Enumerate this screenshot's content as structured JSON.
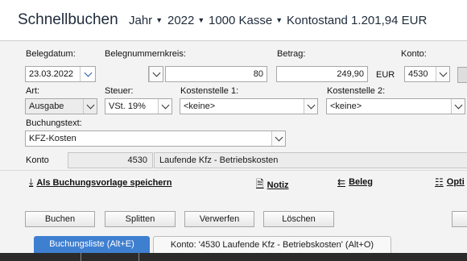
{
  "header": {
    "title": "Schnellbuchen",
    "period_type": "Jahr",
    "year": "2022",
    "account": "1000 Kasse",
    "balance": "Kontostand 1.201,94 EUR"
  },
  "form": {
    "belegdatum_label": "Belegdatum:",
    "belegdatum_value": "23.03.2022",
    "belegnummernkreis_label": "Belegnummernkreis:",
    "belegnummer_value": "80",
    "betrag_label": "Betrag:",
    "betrag_value": "249,90",
    "currency": "EUR",
    "konto_label": "Konto:",
    "konto_value": "4530",
    "art_label": "Art:",
    "art_value": "Ausgabe",
    "steuer_label": "Steuer:",
    "steuer_value": "VSt. 19%",
    "kostenstelle1_label": "Kostenstelle 1:",
    "kostenstelle1_value": "<keine>",
    "kostenstelle2_label": "Kostenstelle 2:",
    "kostenstelle2_value": "<keine>",
    "buchungstext_label": "Buchungstext:",
    "buchungstext_value": "KFZ-Kosten"
  },
  "konto_info": {
    "label": "Konto",
    "number": "4530",
    "description": "Laufende Kfz - Betriebskosten"
  },
  "actions": {
    "save_template": "Als Buchungsvorlage speichern",
    "notiz": "Notiz",
    "beleg": "Beleg",
    "options": "Opti"
  },
  "buttons": {
    "buchen": "Buchen",
    "splitten": "Splitten",
    "verwerfen": "Verwerfen",
    "loeschen": "Löschen"
  },
  "tabs": [
    {
      "label": "Buchungsliste (Alt+E)",
      "active": true
    },
    {
      "label": "Konto: '4530 Laufende Kfz - Betriebskosten' (Alt+O)",
      "active": false
    }
  ],
  "colors": {
    "accent": "#3f7fd0",
    "title": "#1f2b3a"
  }
}
